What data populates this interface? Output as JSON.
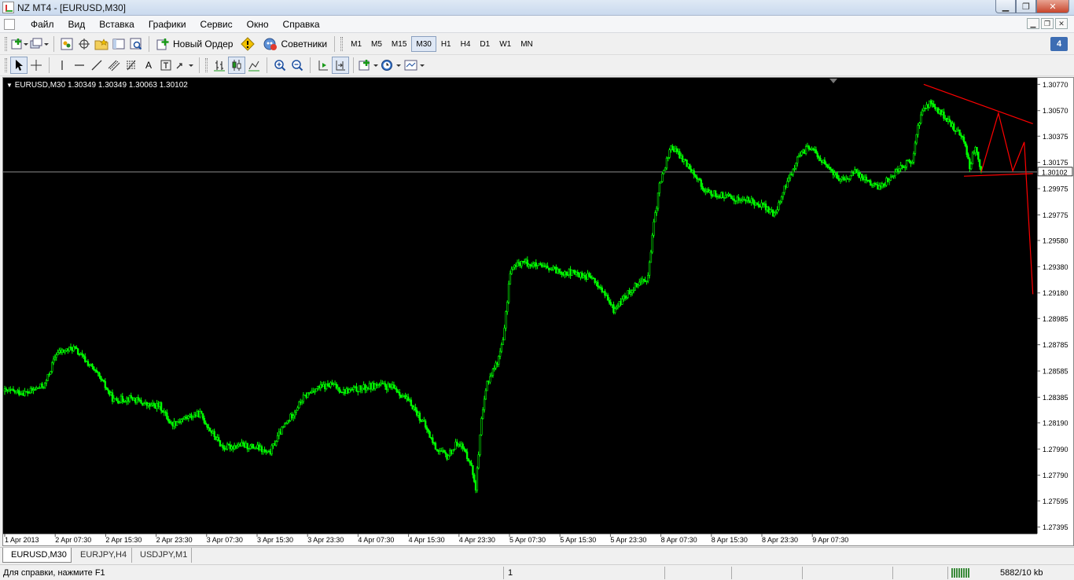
{
  "window": {
    "title": "NZ MT4 - [EURUSD,M30]"
  },
  "menu": {
    "items": [
      "Файл",
      "Вид",
      "Вставка",
      "Графики",
      "Сервис",
      "Окно",
      "Справка"
    ]
  },
  "toolbar": {
    "new_order_label": "Новый Ордер",
    "advisors_label": "Советники",
    "timeframes": [
      "M1",
      "M5",
      "M15",
      "M30",
      "H1",
      "H4",
      "D1",
      "W1",
      "MN"
    ],
    "active_timeframe": "M30",
    "chat_badge": "4"
  },
  "chart": {
    "info_line": "EURUSD,M30  1.30349 1.30349 1.30063 1.30102",
    "current_price": "1.30102",
    "price_labels": [
      "1.30770",
      "1.30570",
      "1.30375",
      "1.30175",
      "1.29975",
      "1.29775",
      "1.29580",
      "1.29380",
      "1.29180",
      "1.28985",
      "1.28785",
      "1.28585",
      "1.28385",
      "1.28190",
      "1.27990",
      "1.27790",
      "1.27595",
      "1.27395"
    ],
    "time_labels": [
      "1 Apr 2013",
      "2 Apr 07:30",
      "2 Apr 15:30",
      "2 Apr 23:30",
      "3 Apr 07:30",
      "3 Apr 15:30",
      "3 Apr 23:30",
      "4 Apr 07:30",
      "4 Apr 15:30",
      "4 Apr 23:30",
      "5 Apr 07:30",
      "5 Apr 15:30",
      "5 Apr 23:30",
      "8 Apr 07:30",
      "8 Apr 15:30",
      "8 Apr 23:30",
      "9 Apr 07:30"
    ],
    "bull_color": "#00ff00",
    "annotation_color": "#ff0000"
  },
  "chart_data": {
    "type": "candlestick",
    "symbol": "EURUSD",
    "timeframe": "M30",
    "ylim": [
      1.27345,
      1.3082
    ],
    "anchors": [
      [
        0,
        1.2843
      ],
      [
        4,
        1.2842
      ],
      [
        7,
        1.2848
      ],
      [
        9,
        1.2872
      ],
      [
        12,
        1.2876
      ],
      [
        15,
        1.2862
      ],
      [
        17,
        1.285
      ],
      [
        19,
        1.2836
      ],
      [
        22,
        1.2838
      ],
      [
        25,
        1.2832
      ],
      [
        27,
        1.2832
      ],
      [
        29,
        1.2818
      ],
      [
        31,
        1.2822
      ],
      [
        34,
        1.2826
      ],
      [
        36,
        1.2812
      ],
      [
        38,
        1.28
      ],
      [
        41,
        1.2802
      ],
      [
        44,
        1.28
      ],
      [
        46,
        1.2795
      ],
      [
        48,
        1.2812
      ],
      [
        50,
        1.2825
      ],
      [
        52,
        1.2838
      ],
      [
        54,
        1.2845
      ],
      [
        57,
        1.2848
      ],
      [
        59,
        1.2843
      ],
      [
        62,
        1.2845
      ],
      [
        65,
        1.2848
      ],
      [
        68,
        1.2845
      ],
      [
        71,
        1.2832
      ],
      [
        73,
        1.2818
      ],
      [
        75,
        1.28
      ],
      [
        77,
        1.2793
      ],
      [
        79,
        1.2805
      ],
      [
        81,
        1.279
      ],
      [
        82,
        1.277
      ],
      [
        83,
        1.282
      ],
      [
        84,
        1.285
      ],
      [
        86,
        1.2868
      ],
      [
        87,
        1.289
      ],
      [
        88,
        1.2935
      ],
      [
        90,
        1.2942
      ],
      [
        93,
        1.2938
      ],
      [
        96,
        1.2935
      ],
      [
        99,
        1.2933
      ],
      [
        102,
        1.293
      ],
      [
        104,
        1.292
      ],
      [
        106,
        1.2905
      ],
      [
        108,
        1.2915
      ],
      [
        110,
        1.2925
      ],
      [
        112,
        1.293
      ],
      [
        113,
        1.297
      ],
      [
        114,
        1.3
      ],
      [
        115,
        1.3015
      ],
      [
        116,
        1.303
      ],
      [
        118,
        1.302
      ],
      [
        120,
        1.301
      ],
      [
        122,
        1.2995
      ],
      [
        124,
        1.2993
      ],
      [
        127,
        1.299
      ],
      [
        130,
        1.2988
      ],
      [
        132,
        1.2985
      ],
      [
        134,
        1.2977
      ],
      [
        136,
        1.3
      ],
      [
        138,
        1.302
      ],
      [
        140,
        1.303
      ],
      [
        142,
        1.302
      ],
      [
        144,
        1.301
      ],
      [
        146,
        1.3003
      ],
      [
        148,
        1.301
      ],
      [
        150,
        1.3005
      ],
      [
        152,
        1.2998
      ],
      [
        154,
        1.3005
      ],
      [
        156,
        1.3015
      ],
      [
        158,
        1.3018
      ],
      [
        159,
        1.3045
      ],
      [
        160,
        1.306
      ],
      [
        161,
        1.3062
      ],
      [
        163,
        1.3055
      ],
      [
        165,
        1.3045
      ],
      [
        167,
        1.3035
      ],
      [
        168,
        1.3015
      ],
      [
        169,
        1.303
      ],
      [
        170,
        1.301
      ]
    ],
    "annotations": [
      {
        "kind": "trendline",
        "points": [
          [
            1.3077,
            160
          ],
          [
            1.3047,
            179
          ]
        ]
      },
      {
        "kind": "trendline",
        "points": [
          [
            1.3007,
            167
          ],
          [
            1.3009,
            179
          ]
        ]
      },
      {
        "kind": "polyline",
        "points": [
          [
            1.301,
            170
          ],
          [
            1.3055,
            173
          ],
          [
            1.3011,
            175.5
          ],
          [
            1.3033,
            177.5
          ],
          [
            1.2917,
            179
          ]
        ]
      }
    ]
  }
}
